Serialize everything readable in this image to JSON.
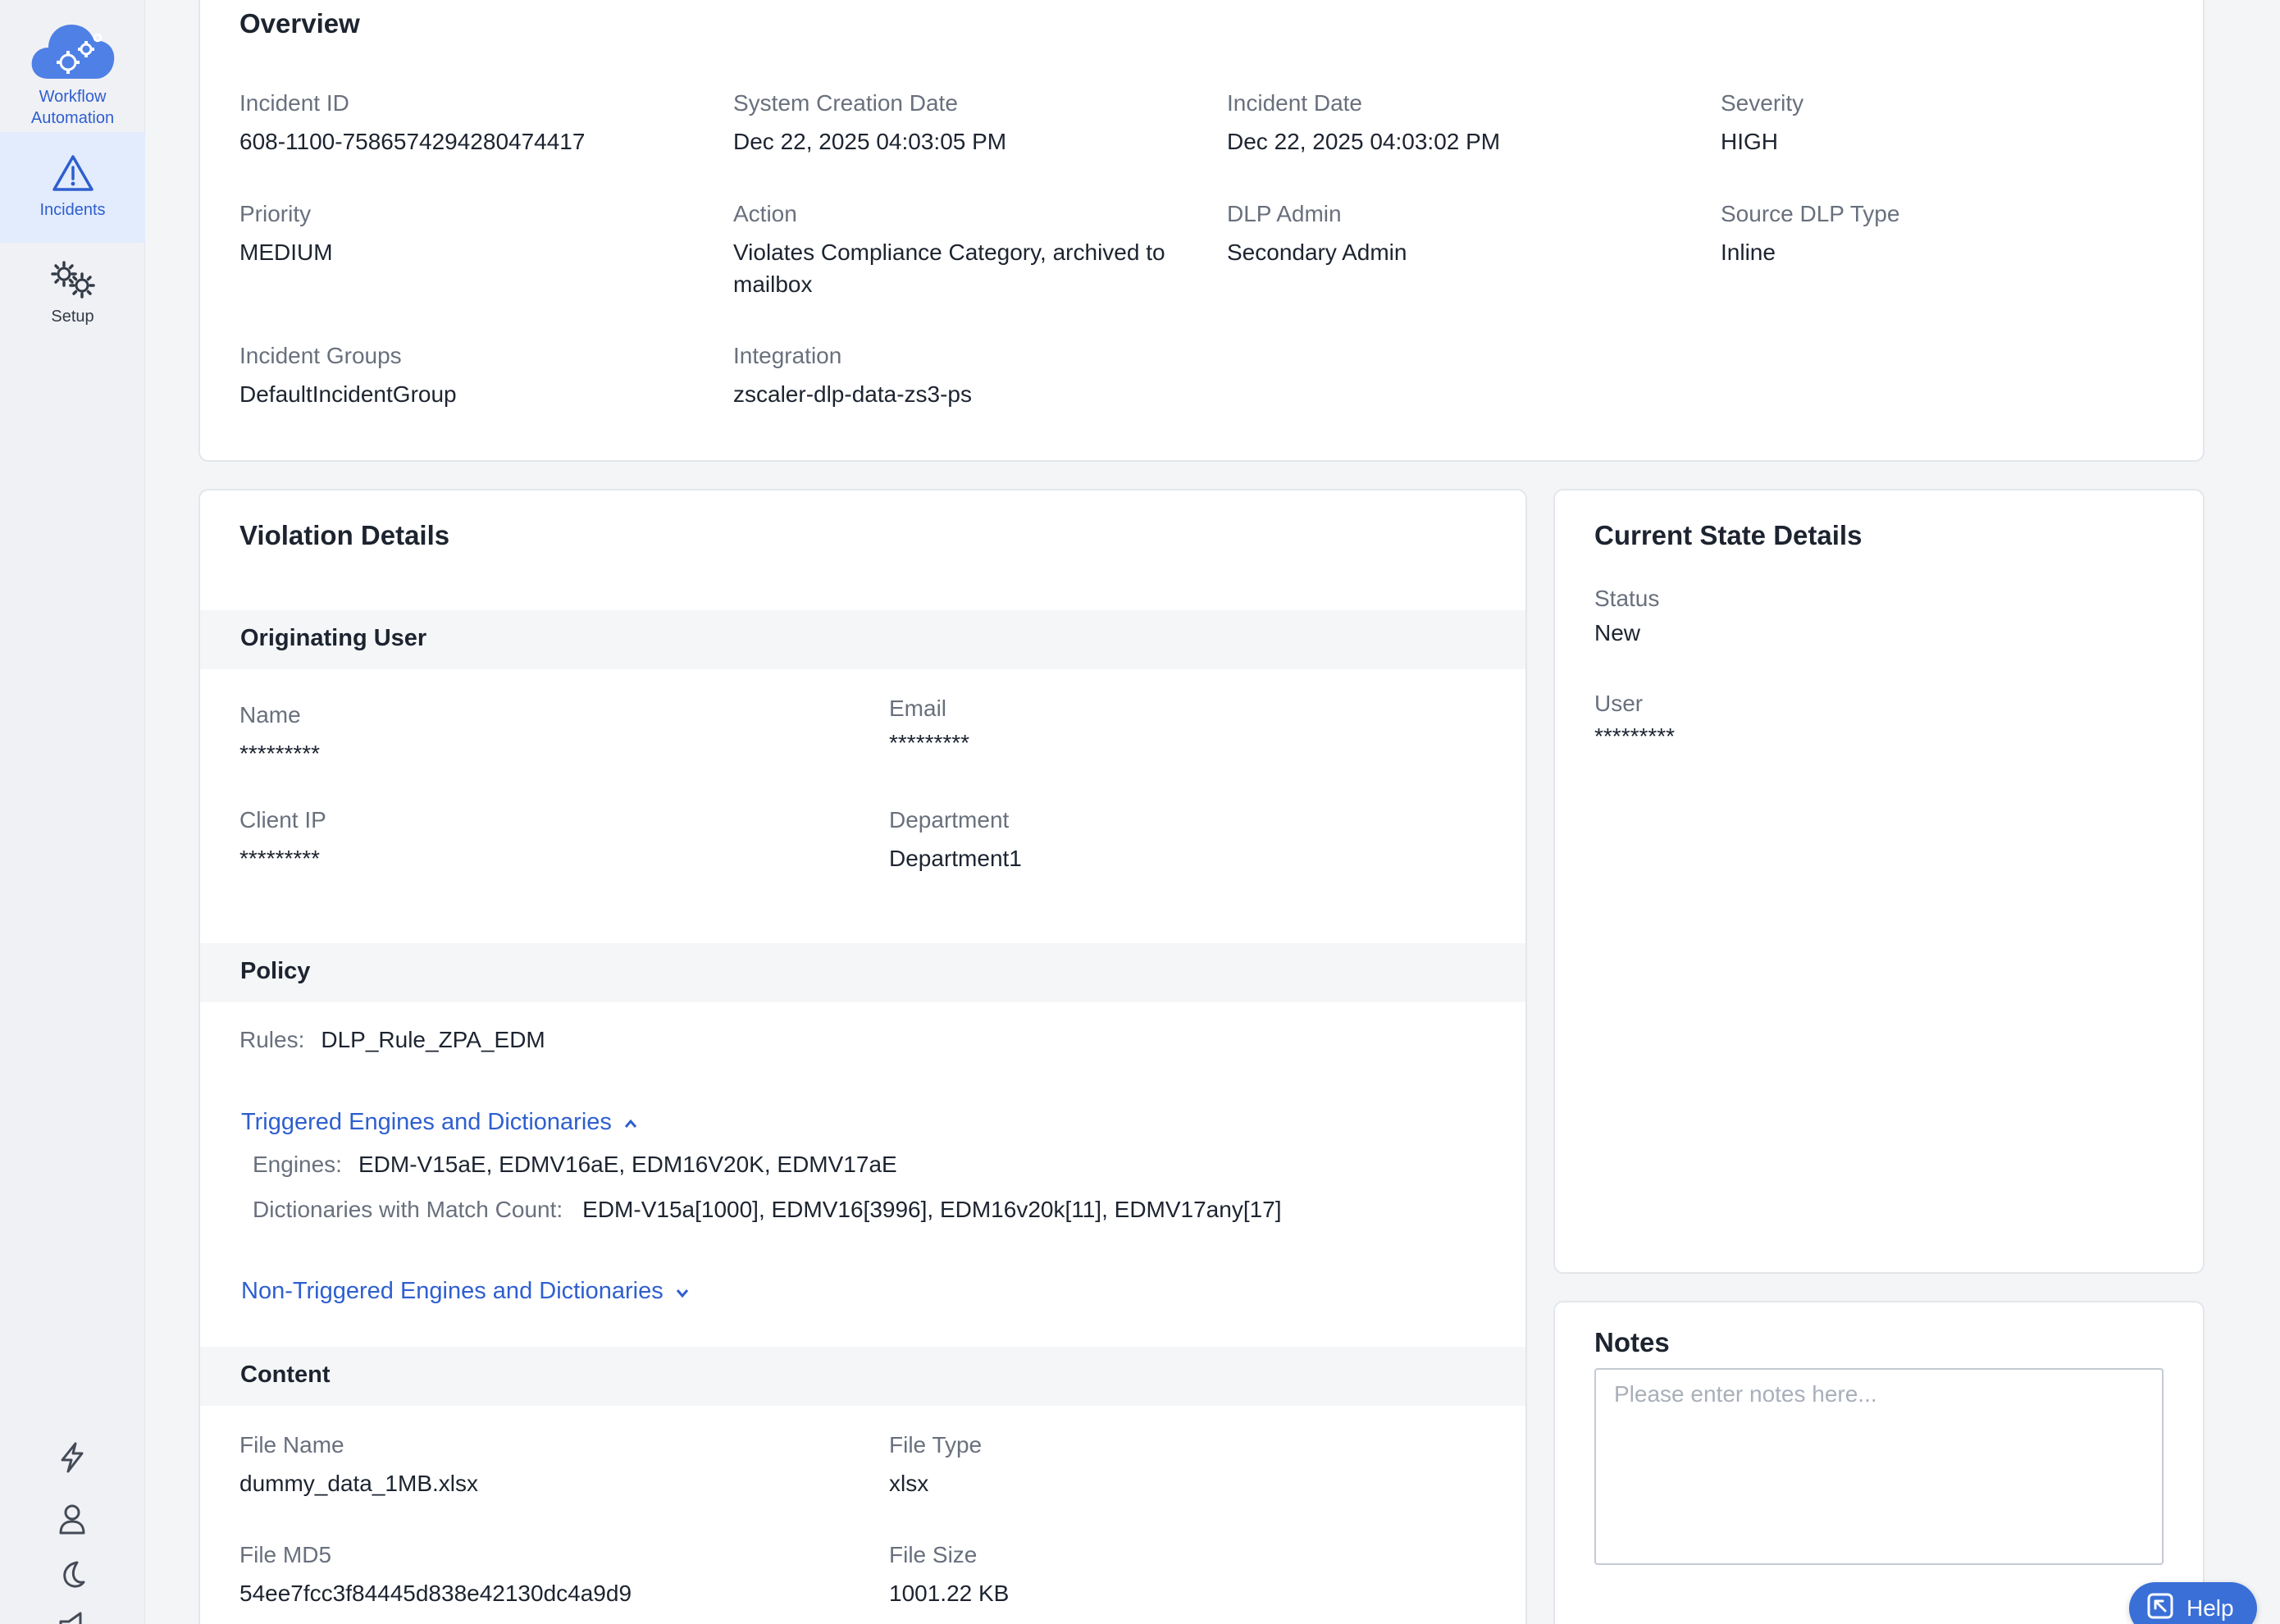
{
  "sidebar": {
    "workflow_label_1": "Workflow",
    "workflow_label_2": "Automation",
    "incidents_label": "Incidents",
    "setup_label": "Setup",
    "bottom_icons": [
      "bolt-icon",
      "user-icon",
      "moon-icon",
      "megaphone-icon"
    ]
  },
  "overview": {
    "title": "Overview",
    "fields": [
      {
        "label": "Incident ID",
        "value": "608-1100-7586574294280474417"
      },
      {
        "label": "System Creation Date",
        "value": "Dec 22, 2025 04:03:05 PM"
      },
      {
        "label": "Incident Date",
        "value": "Dec 22, 2025 04:03:02 PM"
      },
      {
        "label": "Severity",
        "value": "HIGH"
      },
      {
        "label": "Priority",
        "value": "MEDIUM"
      },
      {
        "label": "Action",
        "value": "Violates Compliance Category, archived to mailbox"
      },
      {
        "label": "DLP Admin",
        "value": "Secondary Admin"
      },
      {
        "label": "Source DLP Type",
        "value": "Inline"
      },
      {
        "label": "Incident Groups",
        "value": "DefaultIncidentGroup"
      },
      {
        "label": "Integration",
        "value": "zscaler-dlp-data-zs3-ps"
      }
    ]
  },
  "violation": {
    "title": "Violation Details",
    "originating_user": {
      "heading": "Originating User",
      "name_label": "Name",
      "name_value": "*********",
      "email_label": "Email",
      "email_value": "*********",
      "ip_label": "Client IP",
      "ip_value": "*********",
      "dept_label": "Department",
      "dept_value": "Department1"
    },
    "policy": {
      "heading": "Policy",
      "rules_label": "Rules:",
      "rules_value": "DLP_Rule_ZPA_EDM",
      "triggered_link": "Triggered Engines and Dictionaries",
      "engines_label": "Engines:",
      "engines_value": "EDM-V15aE, EDMV16aE, EDM16V20K, EDMV17aE",
      "dicts_label": "Dictionaries with Match Count:",
      "dicts_value": "EDM-V15a[1000], EDMV16[3996], EDM16v20k[11], EDMV17any[17]",
      "non_triggered_link": "Non-Triggered Engines and Dictionaries"
    },
    "content": {
      "heading": "Content",
      "file_name_label": "File Name",
      "file_name_value": "dummy_data_1MB.xlsx",
      "file_type_label": "File Type",
      "file_type_value": "xlsx",
      "md5_label": "File MD5",
      "md5_value": "54ee7fcc3f84445d838e42130dc4a9d9",
      "size_label": "File Size",
      "size_value": "1001.22 KB"
    }
  },
  "current_state": {
    "title": "Current State Details",
    "status_label": "Status",
    "status_value": "New",
    "user_label": "User",
    "user_value": "*********"
  },
  "notes": {
    "title": "Notes",
    "placeholder": "Please enter notes here..."
  },
  "help": {
    "label": "Help"
  },
  "colors": {
    "accent": "#2e5fcf",
    "help_bg": "#3a6fd8",
    "label_gray": "#69707d"
  }
}
